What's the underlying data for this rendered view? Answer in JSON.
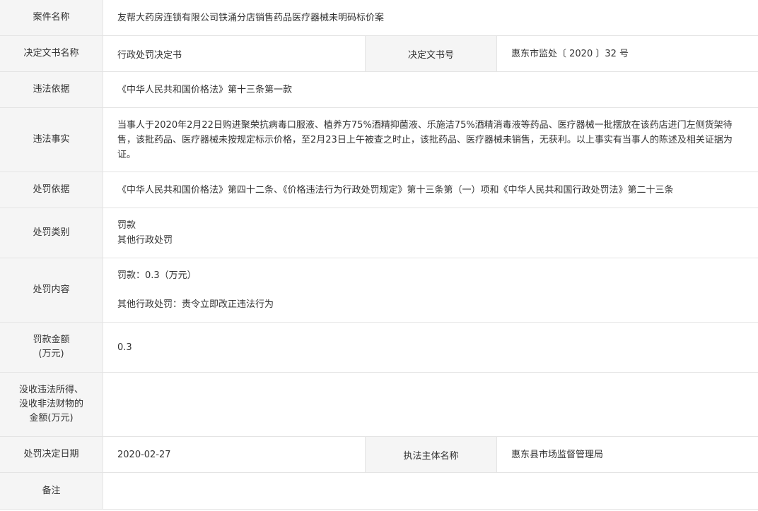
{
  "rows": {
    "case_name": {
      "label": "案件名称",
      "value": "友帮大药房连锁有限公司铁涌分店销售药品医疗器械未明码标价案"
    },
    "doc": {
      "label": "决定文书名称",
      "value": "行政处罚决定书",
      "label2": "决定文书号",
      "value2": "惠东市监处〔 2020 〕32 号"
    },
    "basis": {
      "label": "违法依据",
      "value": "《中华人民共和国价格法》第十三条第一款"
    },
    "facts": {
      "label": "违法事实",
      "value": "当事人于2020年2月22日购进聚荣抗病毒口服液、植养方75%酒精抑菌液、乐施洁75%酒精消毒液等药品、医疗器械一批摆放在该药店进门左侧货架待售，该批药品、医疗器械未按规定标示价格，至2月23日上午被查之时止，该批药品、医疗器械未销售，无获利。以上事实有当事人的陈述及相关证据为证。"
    },
    "penalty_basis": {
      "label": "处罚依据",
      "value": "《中华人民共和国价格法》第四十二条、《价格违法行为行政处罚规定》第十三条第（一）项和《中华人民共和国行政处罚法》第二十三条"
    },
    "penalty_type": {
      "label": "处罚类别",
      "line1": "罚款",
      "line2": "其他行政处罚"
    },
    "penalty_content": {
      "label": "处罚内容",
      "line1": "罚款：0.3（万元）",
      "line2": "其他行政处罚：责令立即改正违法行为"
    },
    "fine": {
      "label_line1": "罚款金额",
      "label_line2": "(万元)",
      "value": "0.3"
    },
    "confiscation": {
      "label_line1": "没收违法所得、",
      "label_line2": "没收非法财物的",
      "label_line3": "金额(万元)",
      "value": ""
    },
    "date": {
      "label": "处罚决定日期",
      "value": "2020-02-27",
      "label2": "执法主体名称",
      "value2": "惠东县市场监督管理局"
    },
    "remark": {
      "label": "备注",
      "value": ""
    }
  }
}
